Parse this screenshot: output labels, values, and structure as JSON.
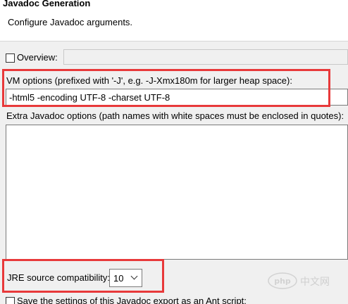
{
  "header": {
    "title": "Javadoc Generation",
    "description": "Configure Javadoc arguments."
  },
  "overview": {
    "label": "Overview:",
    "checked": false,
    "value": ""
  },
  "vm_options": {
    "label": "VM options (prefixed with '-J', e.g. -J-Xmx180m for larger heap space):",
    "value": "-html5 -encoding UTF-8 -charset UTF-8"
  },
  "extra_options": {
    "label": "Extra Javadoc options (path names with white spaces must be enclosed in quotes):",
    "value": ""
  },
  "jre": {
    "label": "JRE source compatibility:",
    "value": "10"
  },
  "save_settings": {
    "label": "Save the settings of this Javadoc export as an Ant script:",
    "checked": false
  },
  "watermark": {
    "logo_text": "php",
    "site_text": "中文网"
  },
  "colors": {
    "highlight": "#e8393a",
    "background": "#f0f0f0"
  }
}
